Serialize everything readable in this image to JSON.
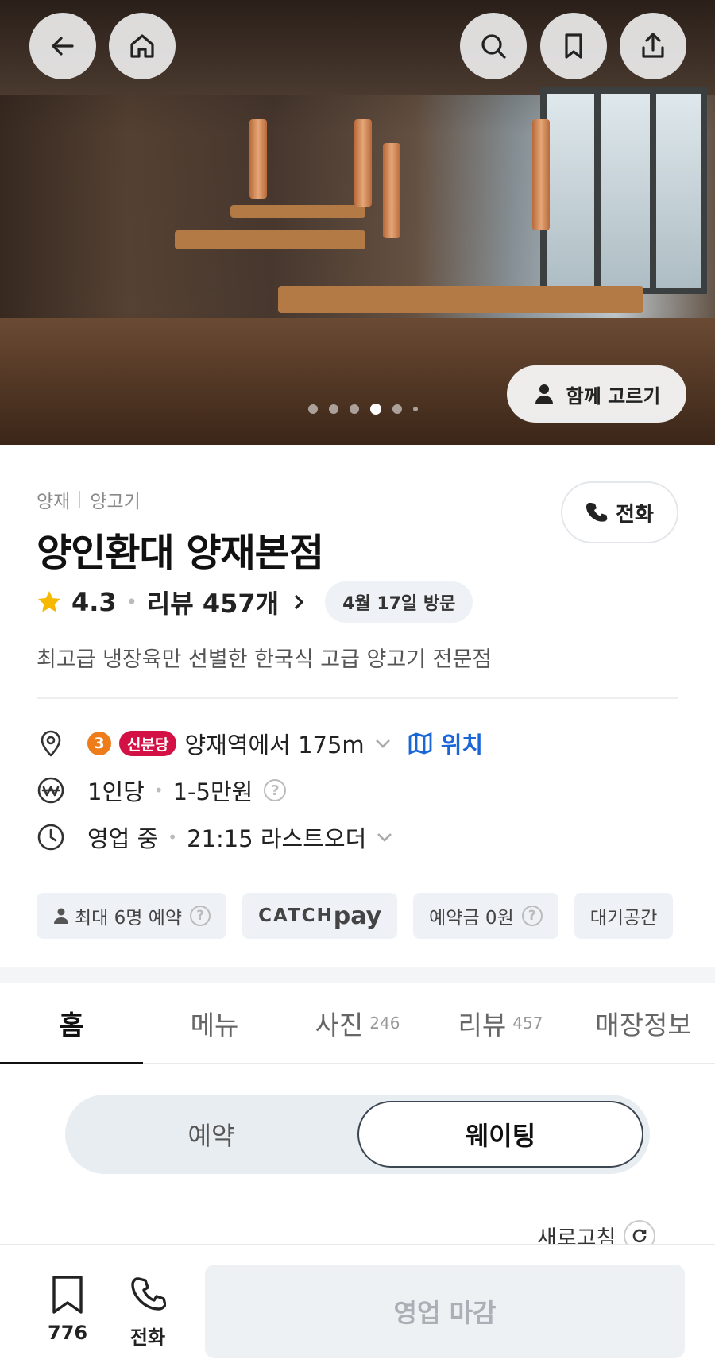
{
  "hero": {
    "photo_alt": "restaurant interior",
    "slide_count": 6,
    "active_slide": 4,
    "together_label": "함께 고르기"
  },
  "top_nav": {
    "back_icon": "arrow-left-icon",
    "home_icon": "home-icon",
    "search_icon": "search-icon",
    "bookmark_icon": "bookmark-icon",
    "share_icon": "share-icon"
  },
  "restaurant": {
    "area": "양재",
    "category": "양고기",
    "name": "양인환대 양재본점",
    "rating": "4.3",
    "review_label": "리뷰 457개",
    "visit_badge": "4월 17일 방문",
    "description": "최고급 냉장육만 선별한 한국식 고급 양고기 전문점",
    "call_label": "전화"
  },
  "info": {
    "subway_line": "3",
    "subway_line_color": "#ef7c1a",
    "subway_line2": "신분당",
    "subway_line2_color": "#d31145",
    "distance": "양재역에서 175m",
    "location_label": "위치",
    "price_prefix": "1인당",
    "price_range": "1-5만원",
    "status": "영업 중",
    "last_order": "21:15 라스트오더"
  },
  "chips": {
    "max_party": "최대 6명 예약",
    "catch": "CATCH",
    "pay": "pay",
    "deposit": "예약금 0원",
    "waiting_space": "대기공간"
  },
  "tabs": [
    {
      "label": "홈",
      "count": ""
    },
    {
      "label": "메뉴",
      "count": ""
    },
    {
      "label": "사진",
      "count": "246"
    },
    {
      "label": "리뷰",
      "count": "457"
    },
    {
      "label": "매장정보",
      "count": ""
    }
  ],
  "segment": {
    "reservation": "예약",
    "waiting": "웨이팅",
    "selected": "웨이팅"
  },
  "refresh_label": "새로고침",
  "bottom_bar": {
    "bookmark_count": "776",
    "call_label": "전화",
    "primary_button": "영업 마감"
  },
  "colors": {
    "accent_blue": "#1a66d6",
    "star": "#f6b800",
    "disabled_text": "#aab0b6"
  }
}
